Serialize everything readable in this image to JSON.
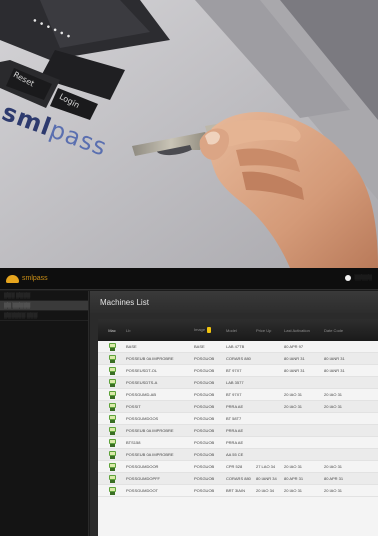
{
  "photo": {
    "brand_part1": "sml",
    "brand_part2": "pass",
    "code_display": "••••••",
    "btn_reset": "Reset",
    "btn_login": "Login"
  },
  "app": {
    "logo_text": "smlpass",
    "user_text": "● ░░░░░░",
    "sidebar": {
      "items": [
        {
          "label": "░░░ ░░░░",
          "active": false
        },
        {
          "label": "░░ ░░░░░",
          "active": true
        },
        {
          "label": "░░░░░░ ░░░",
          "active": false
        }
      ]
    },
    "title": "Machines List",
    "columns": [
      "Mac",
      "Lb",
      "Image",
      "Model",
      "Price Up",
      "Last Activation",
      "Date Code"
    ],
    "rows": [
      [
        "BASE",
        "BASE",
        "LAB 47TB",
        "",
        "80 APR 97",
        ""
      ],
      [
        "POSSEUB 0A IMPROBRE",
        "POSGUOB",
        "CORARS 880",
        "",
        "80 IANR 31",
        "80 IANR 31"
      ],
      [
        "POSSEUSDT-OL",
        "POSGUOB",
        "BT 97X7",
        "",
        "80 IANR 31",
        "80 IANR 31"
      ],
      [
        "POSSEUSDTS-A",
        "POSGUOB",
        "LAB 3577",
        "",
        "",
        ""
      ],
      [
        "POSSGUMD-AB",
        "POSGUOB",
        "BT 97X7",
        "",
        "20 IAO 31",
        "20 IAO 31"
      ],
      [
        "POSSIT",
        "POSGUOB",
        "PRRA AE",
        "",
        "20 IAO 31",
        "20 IAO 31"
      ],
      [
        "POSSGUMDGOS",
        "POSGUOB",
        "BT 58T7",
        "",
        "",
        ""
      ],
      [
        "POSSEUB 0A IMPROBRE",
        "POSGUOB",
        "PRRA AE",
        "",
        "",
        ""
      ],
      [
        "BTS158",
        "POSGUOB",
        "PRRA AE",
        "",
        "",
        ""
      ],
      [
        "POSSEUB 0A IMPROBRE",
        "POSGUOB",
        "AA 55 CE",
        "",
        "",
        ""
      ],
      [
        "POSSGUMDOOR",
        "POSGUOB",
        "CPR 528",
        "27 LAO 34",
        "20 IAO 31",
        "20 IAO 31"
      ],
      [
        "POSSGUMDOPFF",
        "POSGUOB",
        "CORARS 880",
        "80 IANR 34",
        "80 APR 31",
        "80 APR 31"
      ],
      [
        "POSSGUMDOOT",
        "POSGUOB",
        "BRT 3IAIN",
        "20 IAO 34",
        "20 IAO 31",
        "20 IAO 31"
      ]
    ]
  },
  "colors": {
    "accent_gold": "#e6a51e",
    "device_icon_green": "#5ea33a"
  },
  "icons": {
    "key": "key-icon",
    "logo": "logo-arch-icon",
    "machine": "machine-icon",
    "sort": "sort-icon"
  }
}
